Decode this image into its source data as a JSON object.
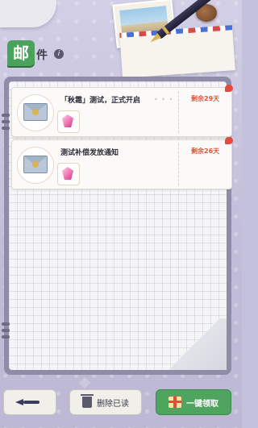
{
  "header": {
    "title_badge": "邮",
    "title_rest": "件",
    "info": "i"
  },
  "mails": [
    {
      "subject": "「秋霜」测试，正式开启",
      "dots": "• • •",
      "expire": "剩余29天"
    },
    {
      "subject": "测试补偿发放通知",
      "dots": "",
      "expire": "剩余26天"
    }
  ],
  "footer": {
    "delete_label": "删除已读",
    "collect_label": "一键领取"
  },
  "colors": {
    "accent_green": "#4fa560",
    "expire_red": "#d85a3b",
    "panel": "#8f8ca8"
  }
}
